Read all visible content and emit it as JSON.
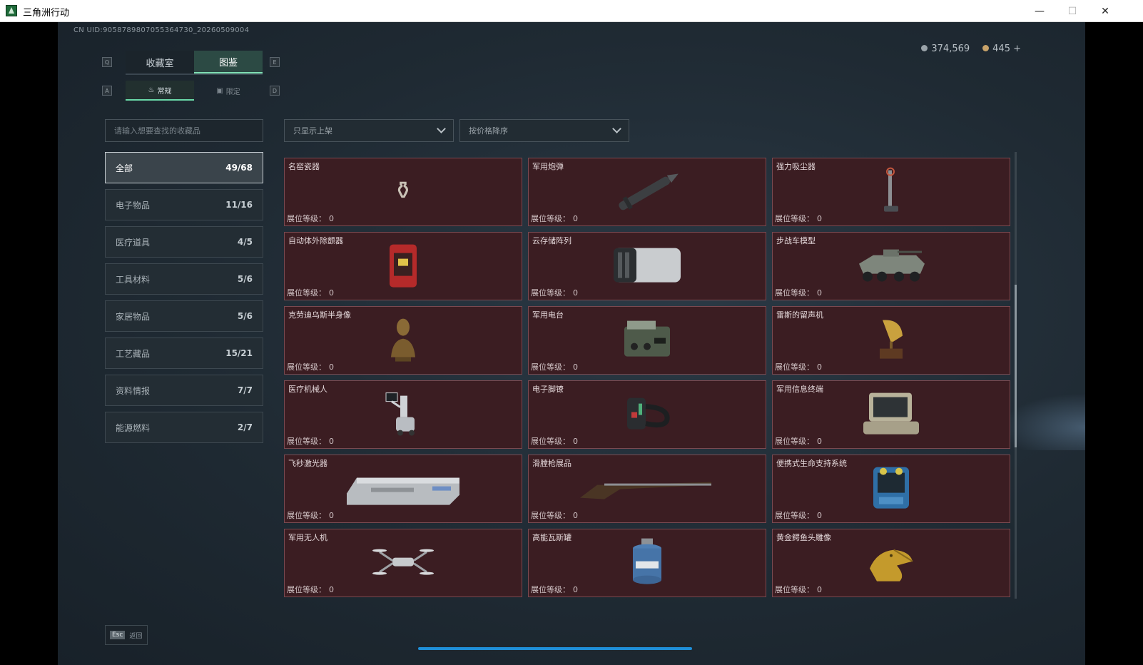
{
  "window": {
    "title": "三角洲行动",
    "minimize": "—",
    "maximize": "☐",
    "close": "✕"
  },
  "header": {
    "uid": "CN UID:9058789807055364730_20260509004",
    "currency": [
      {
        "value": "374,569",
        "color": "#9aa3a9"
      },
      {
        "value": "445 +",
        "color": "#c8a36a"
      }
    ]
  },
  "key_hints": {
    "q": "Q",
    "e": "E",
    "a": "A",
    "d": "D"
  },
  "tabs_main": [
    {
      "label": "收藏室",
      "active": false
    },
    {
      "label": "图鉴",
      "active": true
    }
  ],
  "tabs_sub": [
    {
      "label": "常规",
      "icon": "flame-icon",
      "active": true
    },
    {
      "label": "限定",
      "icon": "box-icon",
      "active": false
    }
  ],
  "search": {
    "placeholder": "请输入想要查找的收藏品"
  },
  "categories": [
    {
      "label": "全部",
      "count": "49/68",
      "active": true
    },
    {
      "label": "电子物品",
      "count": "11/16"
    },
    {
      "label": "医疗道具",
      "count": "4/5"
    },
    {
      "label": "工具材料",
      "count": "5/6"
    },
    {
      "label": "家居物品",
      "count": "5/6"
    },
    {
      "label": "工艺藏品",
      "count": "15/21"
    },
    {
      "label": "资料情报",
      "count": "7/7"
    },
    {
      "label": "能源燃料",
      "count": "2/7"
    }
  ],
  "filters": {
    "shelf": "只显示上架",
    "sort": "按价格降序"
  },
  "level_label": "展位等级：",
  "items": [
    {
      "name": "名窑瓷器",
      "level": "0",
      "icon": "porcelain-vase-icon"
    },
    {
      "name": "军用炮弹",
      "level": "0",
      "icon": "artillery-shell-icon"
    },
    {
      "name": "强力吸尘器",
      "level": "0",
      "icon": "vacuum-cleaner-icon"
    },
    {
      "name": "自动体外除颤器",
      "level": "0",
      "icon": "defibrillator-icon"
    },
    {
      "name": "云存储阵列",
      "level": "0",
      "icon": "storage-array-icon"
    },
    {
      "name": "步战车模型",
      "level": "0",
      "icon": "ifv-model-icon"
    },
    {
      "name": "克劳迪乌斯半身像",
      "level": "0",
      "icon": "bust-icon"
    },
    {
      "name": "军用电台",
      "level": "0",
      "icon": "radio-icon"
    },
    {
      "name": "雷斯的留声机",
      "level": "0",
      "icon": "gramophone-icon"
    },
    {
      "name": "医疗机械人",
      "level": "0",
      "icon": "medical-robot-icon"
    },
    {
      "name": "电子脚镣",
      "level": "0",
      "icon": "ankle-monitor-icon"
    },
    {
      "name": "军用信息终端",
      "level": "0",
      "icon": "terminal-icon"
    },
    {
      "name": "飞秒激光器",
      "level": "0",
      "icon": "laser-icon"
    },
    {
      "name": "滑膛枪展品",
      "level": "0",
      "icon": "musket-icon"
    },
    {
      "name": "便携式生命支持系统",
      "level": "0",
      "icon": "life-support-icon"
    },
    {
      "name": "军用无人机",
      "level": "0",
      "icon": "drone-icon"
    },
    {
      "name": "高能瓦斯罐",
      "level": "0",
      "icon": "gas-canister-icon"
    },
    {
      "name": "黄金鳄鱼头雕像",
      "level": "0",
      "icon": "gold-croc-icon"
    }
  ],
  "footer": {
    "esc_key": "Esc",
    "esc_label": "返回"
  },
  "colors": {
    "card_bg": "#3b1d22",
    "accent": "#7fe0b4"
  }
}
